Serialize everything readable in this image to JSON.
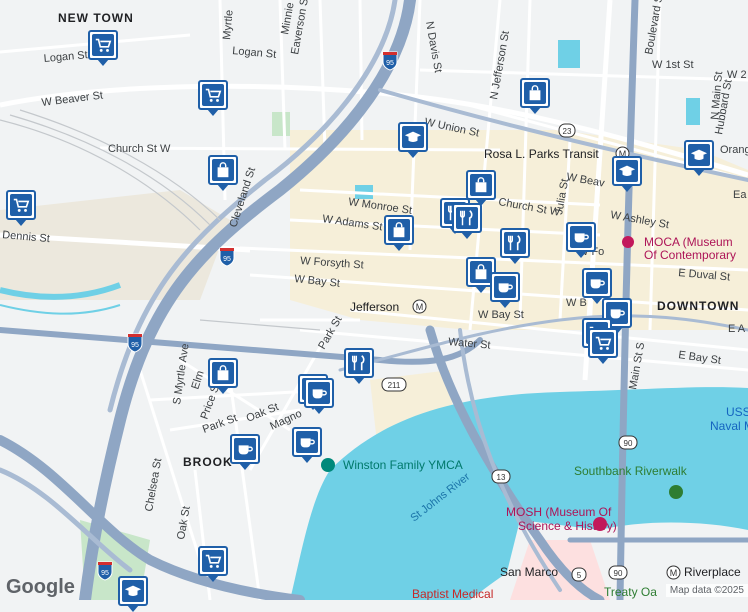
{
  "map": {
    "districts": [
      {
        "name": "new-town",
        "text": "NEW TOWN"
      },
      {
        "name": "downtown",
        "text": "DOWNTOWN"
      },
      {
        "name": "brooklyn",
        "text": "BROOK"
      }
    ],
    "streets": [
      {
        "name": "logan-st-1",
        "text": "Logan St"
      },
      {
        "name": "logan-st-2",
        "text": "Logan St"
      },
      {
        "name": "w-beaver-st",
        "text": "W Beaver St"
      },
      {
        "name": "church-st-w",
        "text": "Church St W"
      },
      {
        "name": "dennis-st",
        "text": "Dennis St"
      },
      {
        "name": "myrtle-ave",
        "text": "Myrtle"
      },
      {
        "name": "s-myrtle-ave",
        "text": "S Myrtle Ave"
      },
      {
        "name": "cleveland-st",
        "text": "Cleveland St"
      },
      {
        "name": "minnie-st",
        "text": "Minnie"
      },
      {
        "name": "everson-st",
        "text": "Eaverson St"
      },
      {
        "name": "n-davis-st",
        "text": "N Davis St"
      },
      {
        "name": "n-jefferson-st",
        "text": "N Jefferson St"
      },
      {
        "name": "w-union-st",
        "text": "W Union St"
      },
      {
        "name": "w-monroe-st",
        "text": "W Monroe St"
      },
      {
        "name": "w-adams-st",
        "text": "W Adams St"
      },
      {
        "name": "w-forsyth-st",
        "text": "W Forsyth St"
      },
      {
        "name": "w-bay-st",
        "text": "W Bay St"
      },
      {
        "name": "w-bay-st-2",
        "text": "W Bay St"
      },
      {
        "name": "water-st",
        "text": "Water St"
      },
      {
        "name": "park-st",
        "text": "Park St"
      },
      {
        "name": "park-st-2",
        "text": "Park St"
      },
      {
        "name": "w-1st-st",
        "text": "W 1st St"
      },
      {
        "name": "w-2nd-st",
        "text": "W 2"
      },
      {
        "name": "church-st-w-2",
        "text": "Church St W"
      },
      {
        "name": "w-ashley-st",
        "text": "W Ashley St"
      },
      {
        "name": "e-duval-st",
        "text": "E Duval St"
      },
      {
        "name": "e-bay-st",
        "text": "E Bay St"
      },
      {
        "name": "julia-st",
        "text": "Julia St"
      },
      {
        "name": "n-main-st",
        "text": "N Main St"
      },
      {
        "name": "main-st-s",
        "text": "Main St S"
      },
      {
        "name": "boulevard-st",
        "text": "Boulevard St"
      },
      {
        "name": "hubbard-st",
        "text": "Hubbard St"
      },
      {
        "name": "oak-st",
        "text": "Oak St"
      },
      {
        "name": "oak-st-2",
        "text": "Oak St"
      },
      {
        "name": "price-st",
        "text": "Price St"
      },
      {
        "name": "chelsea-st",
        "text": "Chelsea St"
      },
      {
        "name": "magnolia-st",
        "text": "Magno"
      },
      {
        "name": "elm-st",
        "text": "Elm"
      },
      {
        "name": "w-beaver-2",
        "text": "W Beav"
      },
      {
        "name": "w-forsyth-2",
        "text": "W Fo"
      },
      {
        "name": "w-bay-3",
        "text": "W B"
      },
      {
        "name": "orange-st",
        "text": "Orange"
      },
      {
        "name": "e-a-st",
        "text": "E A"
      },
      {
        "name": "e-ea",
        "text": "Ea"
      }
    ],
    "pois": [
      {
        "name": "moca",
        "text": "MOCA (Museum",
        "text2": "Of Contemporary"
      },
      {
        "name": "jefferson-station",
        "text": "Jefferson"
      },
      {
        "name": "rosa-parks-transit",
        "text": "Rosa L. Parks Transit"
      },
      {
        "name": "winston-ymca",
        "text": "Winston Family YMCA"
      },
      {
        "name": "southbank-riverwalk",
        "text": "Southbank Riverwalk"
      },
      {
        "name": "mosh",
        "text": "MOSH (Museum Of",
        "text2": "Science & History)"
      },
      {
        "name": "san-marco",
        "text": "San Marco"
      },
      {
        "name": "riverplace",
        "text": "Riverplace"
      },
      {
        "name": "baptist-medical",
        "text": "Baptist Medical"
      },
      {
        "name": "uss-naval",
        "text": "USS",
        "text2": "Naval M"
      },
      {
        "name": "treaty-oak",
        "text": "Treaty Oa"
      }
    ],
    "water": [
      {
        "name": "st-johns-river",
        "text": "St Johns River"
      }
    ],
    "shields": [
      {
        "name": "i95-north",
        "text": "95"
      },
      {
        "name": "i95-mid",
        "text": "95"
      },
      {
        "name": "i95-west",
        "text": "95"
      },
      {
        "name": "i95-south",
        "text": "95"
      },
      {
        "name": "us23",
        "text": "23"
      },
      {
        "name": "sr211",
        "text": "211"
      },
      {
        "name": "sr13",
        "text": "13"
      },
      {
        "name": "us90-1",
        "text": "90"
      },
      {
        "name": "us90-2",
        "text": "90"
      },
      {
        "name": "sr5",
        "text": "5"
      }
    ],
    "markers": [
      {
        "name": "marker-shopping-cart-1",
        "icon": "cart"
      },
      {
        "name": "marker-shopping-cart-2",
        "icon": "cart"
      },
      {
        "name": "marker-shopping-cart-3",
        "icon": "cart"
      },
      {
        "name": "marker-shopping-bag-1",
        "icon": "bag"
      },
      {
        "name": "marker-shopping-bag-2",
        "icon": "bag"
      },
      {
        "name": "marker-shopping-bag-3",
        "icon": "bag"
      },
      {
        "name": "marker-graduation-cap-1",
        "icon": "cap"
      },
      {
        "name": "marker-restaurant-1",
        "icon": "fork"
      },
      {
        "name": "marker-shopping-bag-4",
        "icon": "bag"
      },
      {
        "name": "marker-restaurant-2",
        "icon": "fork"
      },
      {
        "name": "marker-restaurant-3",
        "icon": "fork"
      },
      {
        "name": "marker-shopping-bag-5",
        "icon": "bag"
      },
      {
        "name": "marker-coffee-1",
        "icon": "cup"
      },
      {
        "name": "marker-graduation-cap-2",
        "icon": "cap"
      },
      {
        "name": "marker-graduation-cap-3",
        "icon": "cap"
      },
      {
        "name": "marker-coffee-2",
        "icon": "cup"
      },
      {
        "name": "marker-coffee-3",
        "icon": "cup"
      },
      {
        "name": "marker-coffee-4",
        "icon": "cup"
      },
      {
        "name": "marker-shopping-cart-4",
        "icon": "cart"
      },
      {
        "name": "marker-shopping-bag-6",
        "icon": "bag"
      },
      {
        "name": "marker-coffee-5",
        "icon": "cup"
      },
      {
        "name": "marker-restaurant-4",
        "icon": "fork"
      },
      {
        "name": "marker-coffee-6",
        "icon": "cup"
      },
      {
        "name": "marker-coffee-7",
        "icon": "cup"
      },
      {
        "name": "marker-coffee-8",
        "icon": "cup"
      },
      {
        "name": "marker-shopping-cart-5",
        "icon": "cart"
      },
      {
        "name": "marker-graduation-cap-4",
        "icon": "cap"
      },
      {
        "name": "marker-shopping-cart-6",
        "icon": "cart"
      }
    ],
    "colors": {
      "water": "#6fd0e6",
      "land": "#f1f3f4",
      "highway": "#8fa6c4",
      "major": "#ffffff",
      "park": "#c8e6c9",
      "marker": "#1f5fa8",
      "downtown": "#f6efd9"
    }
  },
  "attribution": {
    "logo": "Google",
    "text": "Map data ©2025"
  }
}
